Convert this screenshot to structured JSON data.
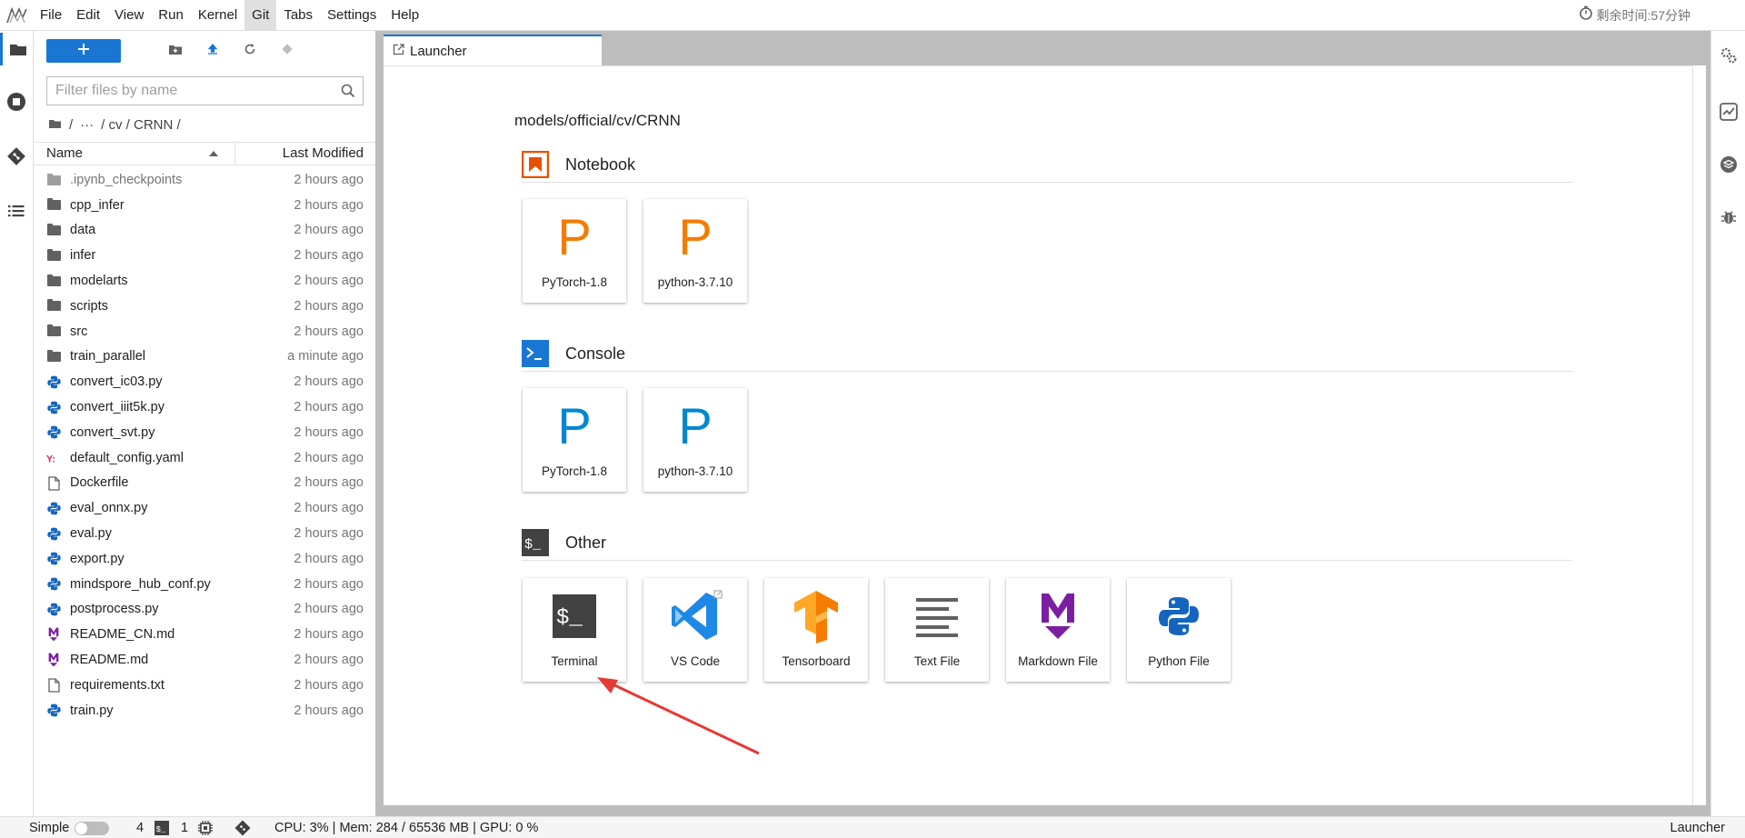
{
  "menubar": {
    "items": [
      "File",
      "Edit",
      "View",
      "Run",
      "Kernel",
      "Git",
      "Tabs",
      "Settings",
      "Help"
    ],
    "active_index": 5,
    "timer": "剩余时间:57分钟"
  },
  "filebrowser": {
    "search_placeholder": "Filter files by name",
    "breadcrumb": {
      "root": "/",
      "ellipsis": "···",
      "path": "/ cv / CRNN /"
    },
    "columns": {
      "name": "Name",
      "modified": "Last Modified"
    },
    "files": [
      {
        "name": ".ipynb_checkpoints",
        "modified": "2 hours ago",
        "type": "folder",
        "dim": true
      },
      {
        "name": "cpp_infer",
        "modified": "2 hours ago",
        "type": "folder"
      },
      {
        "name": "data",
        "modified": "2 hours ago",
        "type": "folder"
      },
      {
        "name": "infer",
        "modified": "2 hours ago",
        "type": "folder"
      },
      {
        "name": "modelarts",
        "modified": "2 hours ago",
        "type": "folder"
      },
      {
        "name": "scripts",
        "modified": "2 hours ago",
        "type": "folder"
      },
      {
        "name": "src",
        "modified": "2 hours ago",
        "type": "folder"
      },
      {
        "name": "train_parallel",
        "modified": "a minute ago",
        "type": "folder"
      },
      {
        "name": "convert_ic03.py",
        "modified": "2 hours ago",
        "type": "python"
      },
      {
        "name": "convert_iiit5k.py",
        "modified": "2 hours ago",
        "type": "python"
      },
      {
        "name": "convert_svt.py",
        "modified": "2 hours ago",
        "type": "python"
      },
      {
        "name": "default_config.yaml",
        "modified": "2 hours ago",
        "type": "yaml"
      },
      {
        "name": "Dockerfile",
        "modified": "2 hours ago",
        "type": "file"
      },
      {
        "name": "eval_onnx.py",
        "modified": "2 hours ago",
        "type": "python"
      },
      {
        "name": "eval.py",
        "modified": "2 hours ago",
        "type": "python"
      },
      {
        "name": "export.py",
        "modified": "2 hours ago",
        "type": "python"
      },
      {
        "name": "mindspore_hub_conf.py",
        "modified": "2 hours ago",
        "type": "python"
      },
      {
        "name": "postprocess.py",
        "modified": "2 hours ago",
        "type": "python"
      },
      {
        "name": "README_CN.md",
        "modified": "2 hours ago",
        "type": "markdown"
      },
      {
        "name": "README.md",
        "modified": "2 hours ago",
        "type": "markdown"
      },
      {
        "name": "requirements.txt",
        "modified": "2 hours ago",
        "type": "file"
      },
      {
        "name": "train.py",
        "modified": "2 hours ago",
        "type": "python"
      }
    ]
  },
  "tabs": [
    {
      "label": "Launcher"
    }
  ],
  "launcher": {
    "cwd": "models/official/cv/CRNN",
    "sections": {
      "notebook": {
        "title": "Notebook",
        "cards": [
          {
            "label": "PyTorch-1.8",
            "glyph": "P"
          },
          {
            "label": "python-3.7.10",
            "glyph": "P"
          }
        ]
      },
      "console": {
        "title": "Console",
        "cards": [
          {
            "label": "PyTorch-1.8",
            "glyph": "P"
          },
          {
            "label": "python-3.7.10",
            "glyph": "P"
          }
        ]
      },
      "other": {
        "title": "Other",
        "cards": [
          {
            "label": "Terminal"
          },
          {
            "label": "VS Code"
          },
          {
            "label": "Tensorboard"
          },
          {
            "label": "Text File"
          },
          {
            "label": "Markdown File"
          },
          {
            "label": "Python File"
          }
        ]
      }
    }
  },
  "statusbar": {
    "mode": "Simple",
    "terminals_count": "4",
    "kernels_count": "1",
    "resources": "CPU: 3% | Mem: 284 / 65536 MB | GPU: 0 %",
    "right": "Launcher"
  },
  "colors": {
    "accent": "#1976d2",
    "notebook_p": "#f57c00",
    "console_p": "#0288d1",
    "notebook_icon": "#e65100",
    "console_icon": "#1976d2",
    "annotation_arrow": "#e53935"
  },
  "icons": {
    "logo": "jupyter-logo",
    "sidebar": [
      "folder-icon",
      "stop-circle-icon",
      "git-icon",
      "list-icon"
    ],
    "rightbar": [
      "property-inspector-icon",
      "resource-monitor-icon",
      "extension-icon",
      "debugger-icon"
    ]
  }
}
